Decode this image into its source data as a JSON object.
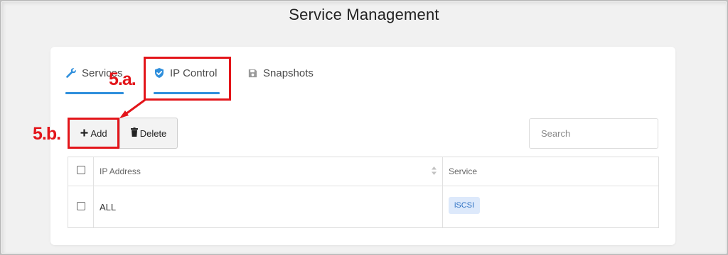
{
  "page": {
    "title": "Service Management"
  },
  "tabs": [
    {
      "label": "Services",
      "icon": "wrench-icon"
    },
    {
      "label": "IP Control",
      "icon": "shield-check-icon",
      "active": true
    },
    {
      "label": "Snapshots",
      "icon": "floppy-disk-icon"
    }
  ],
  "toolbar": {
    "add_label": "Add",
    "add_icon": "plus-icon",
    "delete_label": "Delete",
    "delete_icon": "trash-icon"
  },
  "search": {
    "placeholder": "Search",
    "value": ""
  },
  "table": {
    "columns": [
      "IP Address",
      "Service"
    ],
    "sort_icon": "sort-icon",
    "rows": [
      {
        "ip": "ALL",
        "service": "iSCSI",
        "checked": false
      }
    ]
  },
  "annotations": {
    "step_a": "5.a.",
    "step_b": "5.b.",
    "color": "#e3151a"
  },
  "colors": {
    "accent": "#2f8fdc",
    "tag_bg": "#dde9fb",
    "tag_text": "#2b6fc2"
  }
}
